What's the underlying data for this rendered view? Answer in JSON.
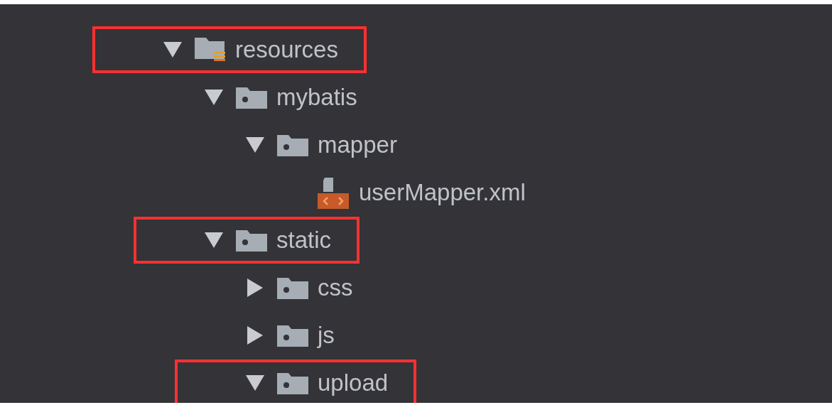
{
  "tree": [
    {
      "label": "resources",
      "kind": "resources-folder",
      "expanded": true,
      "highlighted": true,
      "children": [
        {
          "label": "mybatis",
          "kind": "folder",
          "expanded": true,
          "highlighted": false,
          "children": [
            {
              "label": "mapper",
              "kind": "folder",
              "expanded": true,
              "highlighted": false,
              "children": [
                {
                  "label": "userMapper.xml",
                  "kind": "xml-file",
                  "highlighted": false
                }
              ]
            }
          ]
        },
        {
          "label": "static",
          "kind": "folder",
          "expanded": true,
          "highlighted": true,
          "children": [
            {
              "label": "css",
              "kind": "folder",
              "expanded": false,
              "highlighted": false
            },
            {
              "label": "js",
              "kind": "folder",
              "expanded": false,
              "highlighted": false
            },
            {
              "label": "upload",
              "kind": "folder",
              "expanded": true,
              "highlighted": true
            }
          ]
        }
      ]
    }
  ]
}
